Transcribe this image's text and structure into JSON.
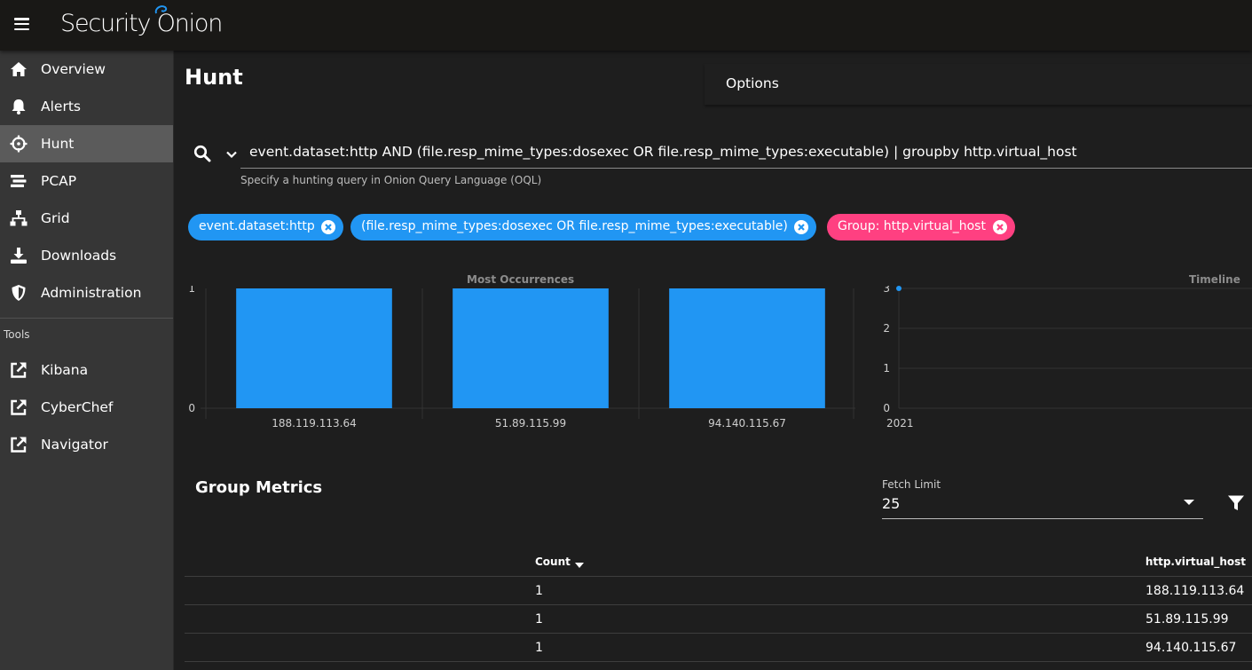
{
  "app": {
    "logo_text": "Security Onion"
  },
  "sidebar": {
    "items": [
      {
        "label": "Overview",
        "icon": "home-icon"
      },
      {
        "label": "Alerts",
        "icon": "bell-icon"
      },
      {
        "label": "Hunt",
        "icon": "crosshairs-icon",
        "active": true
      },
      {
        "label": "PCAP",
        "icon": "stream-icon"
      },
      {
        "label": "Grid",
        "icon": "sitemap-icon"
      },
      {
        "label": "Downloads",
        "icon": "download-icon"
      },
      {
        "label": "Administration",
        "icon": "shield-icon"
      }
    ],
    "tools_title": "Tools",
    "tools": [
      {
        "label": "Kibana",
        "icon": "external-link-icon"
      },
      {
        "label": "CyberChef",
        "icon": "external-link-icon"
      },
      {
        "label": "Navigator",
        "icon": "external-link-icon"
      }
    ]
  },
  "main": {
    "title": "Hunt",
    "options_label": "Options",
    "query": "event.dataset:http AND (file.resp_mime_types:dosexec OR file.resp_mime_types:executable) | groupby http.virtual_host",
    "query_hint": "Specify a hunting query in Onion Query Language (OQL)",
    "chips": [
      {
        "label": "event.dataset:http",
        "color": "blue"
      },
      {
        "label": "(file.resp_mime_types:dosexec OR file.resp_mime_types:executable)",
        "color": "blue"
      },
      {
        "label": "Group: http.virtual_host",
        "color": "pink"
      }
    ],
    "group_metrics_title": "Group Metrics",
    "fetch_limit": {
      "label": "Fetch Limit",
      "value": "25"
    },
    "table": {
      "headers": [
        "Count",
        "http.virtual_host"
      ],
      "rows": [
        [
          "1",
          "188.119.113.64"
        ],
        [
          "1",
          "51.89.115.99"
        ],
        [
          "1",
          "94.140.115.67"
        ]
      ]
    }
  },
  "colors": {
    "bar": "#2196f3",
    "chip_blue": "#2196f3",
    "chip_pink": "#ff4081"
  },
  "chart_data": [
    {
      "type": "bar",
      "title": "Most Occurrences",
      "categories": [
        "188.119.113.64",
        "51.89.115.99",
        "94.140.115.67"
      ],
      "values": [
        1,
        1,
        1
      ],
      "ylim": [
        0,
        1
      ],
      "yticks": [
        "0",
        "1"
      ]
    },
    {
      "type": "scatter",
      "title": "Timeline",
      "x": [
        "2021"
      ],
      "values": [
        3
      ],
      "ylim": [
        0,
        3
      ],
      "yticks": [
        "0",
        "1",
        "2",
        "3"
      ]
    }
  ]
}
